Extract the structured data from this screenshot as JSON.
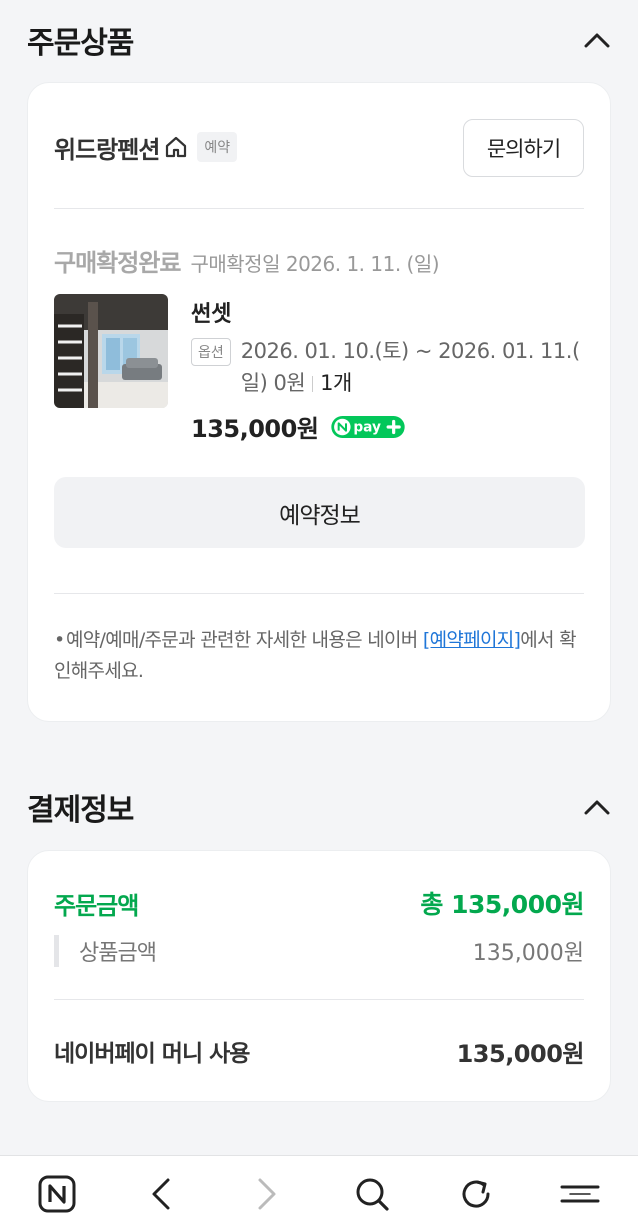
{
  "order": {
    "section_title": "주문상품",
    "store_name": "위드랑펜션",
    "reserve_badge": "예약",
    "inquiry_button": "문의하기",
    "status": "구매확정완료",
    "status_date": "구매확정일 2026. 1. 11. (일)",
    "product_name": "썬셋",
    "option_badge": "옵션",
    "option_text_line1": "2026. 01. 10.(토) ~ 2026. 01. 11.(",
    "option_text_line2": "일) 0원",
    "option_qty": "1개",
    "price": "135,000원",
    "npay_label": "pay",
    "reservation_info_button": "예약정보",
    "notice_prefix": "예약/예매/주문과 관련한 자세한 내용은 네이버 ",
    "notice_link": "[예약페이지]",
    "notice_suffix": "에서 확인해주세요."
  },
  "payment": {
    "section_title": "결제정보",
    "order_amount_label": "주문금액",
    "order_amount_value": "총 135,000원",
    "product_amount_label": "상품금액",
    "product_amount_value": "135,000원",
    "npay_money_label": "네이버페이 머니 사용",
    "npay_money_value": "135,000원"
  },
  "bottom_nav": {
    "icons": [
      "naver-home-icon",
      "back-icon",
      "forward-icon",
      "search-icon",
      "refresh-icon",
      "menu-icon"
    ]
  },
  "colors": {
    "accent_green": "#03a84e",
    "link_blue": "#1f76d8"
  }
}
